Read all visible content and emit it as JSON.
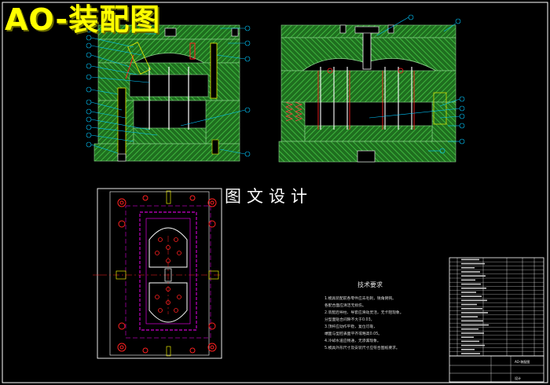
{
  "header": {
    "title": "AO-装配图"
  },
  "drawing": {
    "caption": "图文设计",
    "colors": {
      "background": "#000000",
      "frame": "#ffffff",
      "hatch_green": "#3cb43c",
      "dim_cyan": "#00c8ff",
      "magenta": "#ff00ff",
      "red": "#ff2020",
      "yellow": "#ffff00",
      "body_yellow": "#e6e600"
    },
    "balloon_count_left": 22,
    "balloon_count_right": 8
  },
  "notes": {
    "title": "技术要求",
    "lines": [
      "1.模具装配前各零件应去毛刺，锐角倒钝。",
      "   各配合面应清洁无损伤。",
      "2.装配后导柱、导套应滑动灵活，无卡阻现象。",
      "   分型面贴合间隙不大于0.03。",
      "3.顶杆应动作平稳，复位可靠，",
      "   端面与型腔表面平齐或略高0.05。",
      "4.冷却水道应畅通，无渗漏现象。",
      "5.模具外形尺寸及安装尺寸应符合图纸要求。"
    ]
  },
  "title_block": {
    "label_a": "AO-装配图",
    "label_b": "设计"
  }
}
